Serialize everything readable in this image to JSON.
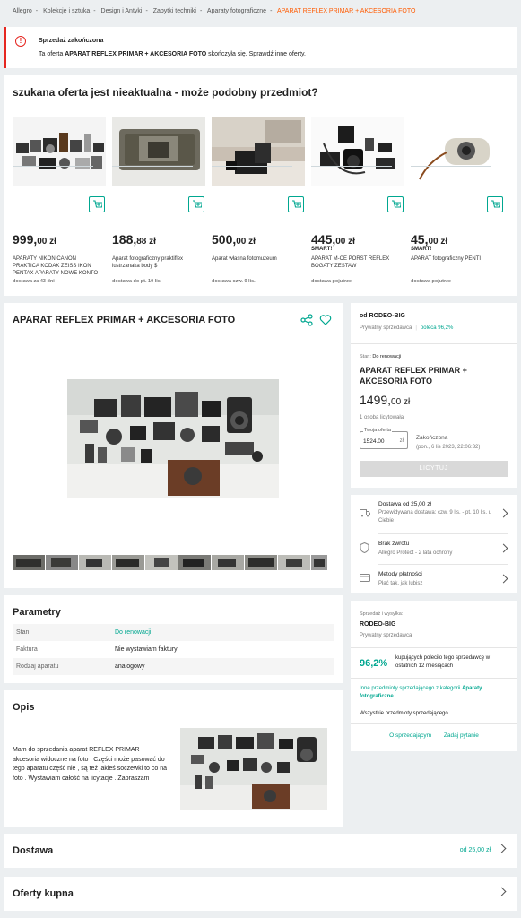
{
  "breadcrumb": [
    "Allegro",
    "Kolekcje i sztuka",
    "Design i Antyki",
    "Zabytki techniki",
    "Aparaty fotograficzne",
    "APARAT REFLEX PRIMAR + AKCESORIA FOTO"
  ],
  "alert": {
    "title": "Sprzedaż zakończona",
    "text_prefix": "Ta oferta",
    "text_bold": "APARAT REFLEX PRIMAR + AKCESORIA FOTO",
    "text_suffix": "skończyła się. Sprawdź inne oferty."
  },
  "similar": {
    "heading": "szukana oferta jest nieaktualna - może podobny przedmiot?",
    "items": [
      {
        "price_main": "999,",
        "price_cents": "00 zł",
        "smart": "",
        "title": "APARATY NIKON CANON PRAKTICA KODAK ZEISS IKON PENTAX APARATY NOWE KONTO",
        "shipping": "dostawa za 43 dni"
      },
      {
        "price_main": "188,",
        "price_cents": "88 zł",
        "smart": "",
        "title": "Aparat fotograficzny praktiflex lustrzanaka body $",
        "shipping": "dostawa do pt. 10 lis."
      },
      {
        "price_main": "500,",
        "price_cents": "00 zł",
        "smart": "",
        "title": "Aparat własna fotomuzeum",
        "shipping": "dostawa czw. 9 lis."
      },
      {
        "price_main": "445,",
        "price_cents": "00 zł",
        "smart": "SMART!",
        "title": "APARAT M-CE PORST REFLEX BOGATY ZESTAW",
        "shipping": "dostawa pojutrze"
      },
      {
        "price_main": "45,",
        "price_cents": "00 zł",
        "smart": "SMART!",
        "title": "APARAT fotograficzny PENTI",
        "shipping": "dostawa pojutrze"
      }
    ]
  },
  "product": {
    "title": "APARAT REFLEX PRIMAR + AKCESORIA FOTO"
  },
  "params": {
    "heading": "Parametry",
    "rows": [
      {
        "k": "Stan",
        "v": "Do renowacji"
      },
      {
        "k": "Faktura",
        "v": "Nie wystawiam faktury"
      },
      {
        "k": "Rodzaj aparatu",
        "v": "analogowy"
      }
    ]
  },
  "opis": {
    "heading": "Opis",
    "text": "Mam do sprzedania aparat REFLEX PRIMAR + akcesoria widoczne na foto . Części może pasować do tego aparatu część nie , są też jakieś soczewki to co na foto . Wystawiam całość na licytacje . Zapraszam ."
  },
  "dostawa": {
    "label": "Dostawa",
    "value": "od 25,00 zł"
  },
  "oferty": {
    "label": "Oferty kupna"
  },
  "buy": {
    "seller_prefix": "od",
    "seller_name": "RODEO-BIG",
    "seller_type": "Prywatny sprzedawca",
    "recommend": "poleca 96,2%",
    "stan_label": "Stan:",
    "stan_value": "Do renowacji",
    "title": "APARAT REFLEX PRIMAR + AKCESORIA FOTO",
    "price_main": "1499,",
    "price_cents": "00 zł",
    "bids": "1 osoba licytowała",
    "offer_label": "Twoja oferta",
    "offer_value": "1524.00",
    "offer_currency": "zł",
    "ended_label": "Zakończona",
    "ended_date": "(pon., 6 lis 2023, 22:06:32)",
    "bid_button": "LICYTUJ"
  },
  "info": {
    "delivery_title": "Dostawa od 25,00 zł",
    "delivery_sub": "Przewidywana dostawa: czw. 9 lis. - pt. 10 lis. u Ciebie",
    "returns_title": "Brak zwrotu",
    "returns_sub": "Allegro Protect - 2 lata ochrony",
    "payment_title": "Metody płatności",
    "payment_sub": "Płać tak, jak lubisz"
  },
  "seller": {
    "label": "Sprzedaż i wysyłka:",
    "name": "RODEO-BIG",
    "type": "Prywatny sprzedawca",
    "pct": "96,2%",
    "pct_text": "kupujących poleciło tego sprzedawcę w ostatnich 12 miesiącach",
    "other_prefix": "Inne przedmioty sprzedającego z kategorii",
    "other_cat": "Aparaty fotograficzne",
    "all": "Wszystkie przedmioty sprzedającego",
    "about": "O sprzedającym",
    "ask": "Zadaj pytanie"
  }
}
